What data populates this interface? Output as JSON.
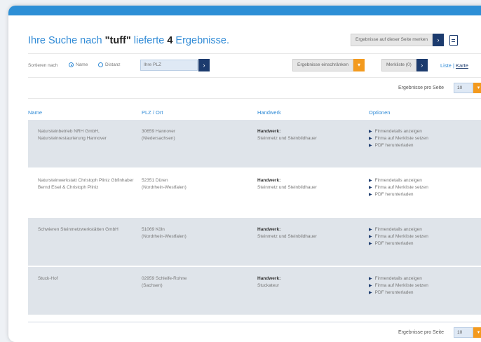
{
  "header": {
    "prefix": "Ihre Suche nach ",
    "query": "\"tuff\"",
    "middle": " lieferte ",
    "count": "4",
    "suffix": " Ergebnisse.",
    "bookmark_button": "Ergebnisse auf dieser Seite merken"
  },
  "sort": {
    "label": "Sortieren nach",
    "option_name": "Name",
    "option_distance": "Distanz",
    "plz_placeholder": "Ihre PLZ",
    "filter_button": "Ergebnisse einschränken",
    "watchlist_button": "Merkliste (0)",
    "view_list": "Liste",
    "view_separator": "|",
    "view_map": "Karte"
  },
  "per_page": {
    "label": "Ergebnisse pro Seite",
    "value": "10"
  },
  "table": {
    "columns": [
      "Name",
      "PLZ / Ort",
      "Handwerk",
      "Optionen"
    ],
    "options": [
      "Firmendetails anzeigen",
      "Firma auf Merkliste setzen",
      "PDF herunterladen"
    ],
    "handwerk_label": "Handwerk:",
    "rows": [
      {
        "name": "Natursteinbetrieb NRH GmbH, Natursteinrestaurierung Hannover",
        "plz": "30659 Hannover",
        "region": "(Niedersachsen)",
        "handwerk": "Steinmetz und Steinbildhauer"
      },
      {
        "name": "Natursteinwerkstatt Christoph Pliniz Gbfinhaber Bernd Eisel & Christoph Pliniz",
        "plz": "52351 Düren",
        "region": "(Nordrhein-Westfalen)",
        "handwerk": "Steinmetz und Steinbildhauer"
      },
      {
        "name": "Schwieren Steinmetzwerkstätten GmbH",
        "plz": "51069 Köln",
        "region": "(Nordrhein-Westfalen)",
        "handwerk": "Steinmetz und Steinbildhauer"
      },
      {
        "name": "Stuck-Hof",
        "plz": "02959 Schleife-Rohne",
        "region": "(Sachsen)",
        "handwerk": "Stuckateur"
      }
    ]
  }
}
